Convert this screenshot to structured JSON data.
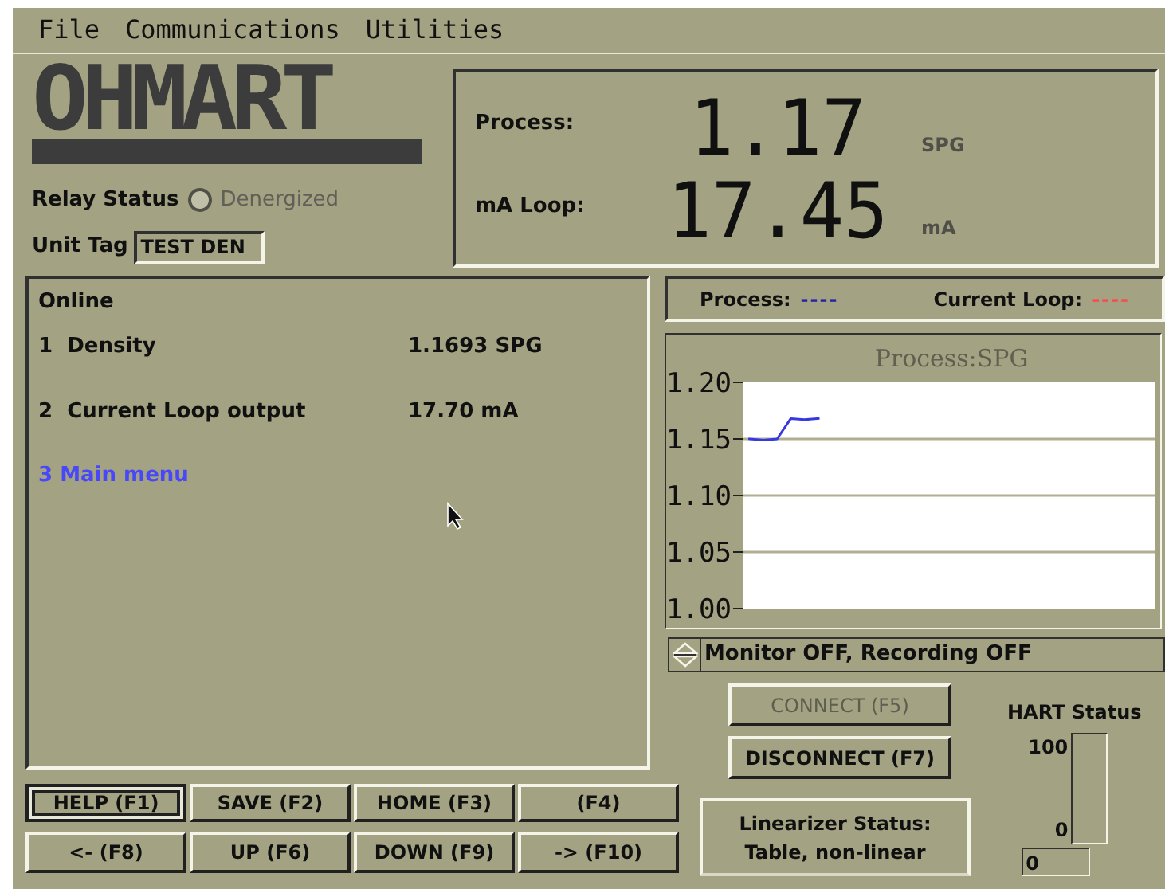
{
  "menu": [
    "File",
    "Communications",
    "Utilities"
  ],
  "logo": "OHMART",
  "relay_status": {
    "label": "Relay Status",
    "value": "Denergized",
    "on": false
  },
  "unit_tag": {
    "label": "Unit Tag",
    "value": "TEST DEN"
  },
  "display": [
    {
      "label": "Process:",
      "value": "1.17",
      "unit": "SPG"
    },
    {
      "label": "mA Loop:",
      "value": "17.45",
      "unit": "mA"
    }
  ],
  "menu_panel": {
    "title": "Online",
    "items": [
      {
        "number": "1",
        "label": "Density",
        "value": "1.1693 SPG",
        "kind": "value"
      },
      {
        "number": "2",
        "label": "Current Loop output",
        "value": "17.70 mA",
        "kind": "value"
      },
      {
        "number": "3",
        "label": "Main menu",
        "kind": "link"
      }
    ]
  },
  "legend": [
    {
      "label": "Process:",
      "mark": "----",
      "color": "#2424a8"
    },
    {
      "label": "Current Loop:",
      "mark": "----",
      "color": "#ff4848"
    }
  ],
  "chart": {
    "chart_data": {
      "type": "line",
      "title": "Process:SPG",
      "grid": true,
      "categories": [
        null,
        null,
        null,
        null,
        null,
        null,
        null,
        null,
        null,
        null,
        null,
        null,
        null,
        null,
        null,
        null,
        null,
        null,
        null,
        null,
        null,
        null,
        null,
        null,
        null,
        null,
        null,
        null,
        null,
        null
      ],
      "ylim": [
        1.0,
        1.2
      ],
      "yticks": [
        {
          "value": 1.2,
          "label": "1.20"
        },
        {
          "value": 1.15,
          "label": "1.15"
        },
        {
          "value": 1.1,
          "label": "1.10"
        },
        {
          "value": 1.05,
          "label": "1.05"
        },
        {
          "value": 1.0,
          "label": "1.00"
        }
      ],
      "series": [
        {
          "color": "#3838e0",
          "values": [
            1.15,
            1.149,
            1.15,
            1.168,
            1.167,
            1.168,
            null,
            null,
            null,
            null,
            null,
            null,
            null,
            null,
            null,
            null,
            null,
            null,
            null,
            null,
            null,
            null,
            null,
            null,
            null,
            null,
            null,
            null,
            null,
            null
          ]
        }
      ]
    }
  },
  "status_bar": "Monitor OFF, Recording OFF",
  "connect_buttons": [
    {
      "label": "CONNECT (F5)",
      "disabled": true
    },
    {
      "label": "DISCONNECT (F7)",
      "disabled": false
    }
  ],
  "hart_status": {
    "title": "HART Status",
    "max": "100",
    "min": "0",
    "level": 0,
    "value": "0"
  },
  "linearizer": [
    "Linearizer Status:",
    "Table, non-linear"
  ],
  "function_keys": [
    {
      "label": "HELP (F1)",
      "focused": true
    },
    {
      "label": "SAVE (F2)",
      "focused": false
    },
    {
      "label": "HOME (F3)",
      "focused": false
    },
    {
      "label": "(F4)",
      "focused": false
    },
    {
      "label": "<- (F8)",
      "focused": false
    },
    {
      "label": "UP (F6)",
      "focused": false
    },
    {
      "label": "DOWN (F9)",
      "focused": false
    },
    {
      "label": "-> (F10)",
      "focused": false
    }
  ]
}
